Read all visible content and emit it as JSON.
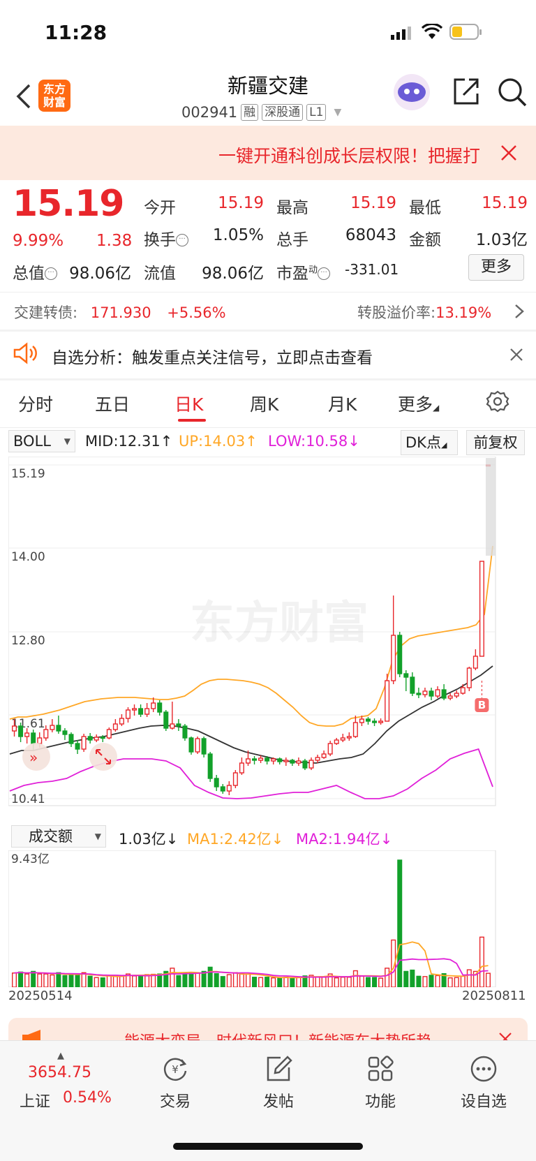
{
  "status_bar": {
    "time": "11:28"
  },
  "header": {
    "logo_text": "东方财富",
    "stock_name": "新疆交建",
    "stock_code": "002941",
    "tags": [
      "融",
      "深股通",
      "L1"
    ]
  },
  "banner": {
    "text": "一键开通科创成长层权限！把握打"
  },
  "quote": {
    "price": "15.19",
    "change_pct": "9.99%",
    "change": "1.38",
    "open_label": "今开",
    "open": "15.19",
    "high_label": "最高",
    "high": "15.19",
    "low_label": "最低",
    "low": "15.19",
    "turnover_label": "换手",
    "turnover": "1.05%",
    "volume_label": "总手",
    "volume": "68043",
    "amount_label": "金额",
    "amount": "1.03亿",
    "mktcap_label": "总值",
    "mktcap": "98.06亿",
    "float_label": "流值",
    "float_cap": "98.06亿",
    "pe_label": "市盈",
    "pe_sup": "动",
    "pe": "-331.01",
    "more_label": "更多"
  },
  "bond": {
    "label": "交建转债:",
    "price": "171.930",
    "change": "+5.56%",
    "premium_label": "转股溢价率:",
    "premium": "13.19%"
  },
  "analysis": {
    "text": "自选分析：触发重点关注信号，立即点击查看"
  },
  "tabs": [
    "分时",
    "五日",
    "日K",
    "周K",
    "月K",
    "更多"
  ],
  "active_tab": "日K",
  "indicator": {
    "name": "BOLL",
    "mid": "MID:12.31",
    "up": "UP:14.03",
    "low": "LOW:10.58",
    "dk_label": "DK点",
    "adjust_label": "前复权"
  },
  "price_axis": [
    "15.19",
    "14.00",
    "12.80",
    "11.61",
    "10.41"
  ],
  "watermark": "东方财富",
  "buy_marker": "B",
  "volume_indicator": {
    "name": "成交额",
    "value": "1.03亿",
    "ma1": "MA1:2.42亿",
    "ma2": "MA2:1.94亿",
    "max_label": "9.43亿"
  },
  "dates": {
    "start": "20250514",
    "end": "20250811"
  },
  "ad": {
    "text": "能源大变局，时代新风口！新能源车大势所趋"
  },
  "bottom_nav": {
    "index_value": "3654.75",
    "index_name": "上证",
    "index_change": "0.54%",
    "items": [
      "交易",
      "发帖",
      "功能",
      "设自选"
    ]
  },
  "colors": {
    "up": "#e8262b",
    "down": "#12a12a",
    "mid": "#333333",
    "upper": "#ffa726",
    "lower": "#e020d8"
  },
  "chart_data": {
    "type": "candlestick",
    "x_range": [
      "20250514",
      "20250811"
    ],
    "ylim": [
      10.41,
      15.19
    ],
    "candles": [
      [
        11.38,
        11.45,
        11.55,
        11.3
      ],
      [
        11.45,
        11.3,
        11.5,
        11.22
      ],
      [
        11.3,
        11.35,
        11.42,
        11.2
      ],
      [
        11.35,
        11.2,
        11.4,
        11.1
      ],
      [
        11.2,
        11.28,
        11.36,
        11.14
      ],
      [
        11.28,
        11.4,
        11.46,
        11.24
      ],
      [
        11.4,
        11.46,
        11.55,
        11.36
      ],
      [
        11.46,
        11.38,
        11.6,
        11.34
      ],
      [
        11.38,
        11.33,
        11.42,
        11.25
      ],
      [
        11.33,
        11.2,
        11.36,
        11.15
      ],
      [
        11.2,
        11.12,
        11.25,
        11.05
      ],
      [
        11.12,
        11.3,
        11.34,
        11.08
      ],
      [
        11.3,
        11.25,
        11.35,
        11.2
      ],
      [
        11.25,
        11.29,
        11.33,
        11.22
      ],
      [
        11.29,
        11.28,
        11.32,
        11.22
      ],
      [
        11.28,
        11.4,
        11.43,
        11.26
      ],
      [
        11.4,
        11.48,
        11.55,
        11.37
      ],
      [
        11.48,
        11.56,
        11.62,
        11.45
      ],
      [
        11.56,
        11.68,
        11.72,
        11.5
      ],
      [
        11.68,
        11.7,
        11.76,
        11.6
      ],
      [
        11.7,
        11.62,
        11.76,
        11.58
      ],
      [
        11.62,
        11.7,
        11.78,
        11.58
      ],
      [
        11.7,
        11.78,
        11.86,
        11.65
      ],
      [
        11.78,
        11.65,
        11.82,
        11.6
      ],
      [
        11.65,
        11.42,
        11.68,
        11.38
      ],
      [
        11.42,
        11.48,
        11.8,
        11.4
      ],
      [
        11.48,
        11.45,
        11.55,
        11.38
      ],
      [
        11.45,
        11.28,
        11.48,
        11.24
      ],
      [
        11.28,
        11.08,
        11.3,
        11.04
      ],
      [
        11.08,
        11.27,
        11.3,
        11.05
      ],
      [
        11.27,
        11.05,
        11.3,
        11.0
      ],
      [
        11.05,
        10.7,
        11.08,
        10.65
      ],
      [
        10.7,
        10.58,
        10.75,
        10.52
      ],
      [
        10.58,
        10.52,
        10.62,
        10.48
      ],
      [
        10.52,
        10.6,
        10.66,
        10.46
      ],
      [
        10.6,
        10.78,
        10.82,
        10.56
      ],
      [
        10.78,
        10.92,
        11.0,
        10.75
      ],
      [
        10.92,
        10.98,
        11.1,
        10.88
      ],
      [
        10.98,
        10.96,
        11.02,
        10.9
      ],
      [
        10.96,
        10.99,
        11.03,
        10.92
      ],
      [
        10.99,
        10.95,
        11.02,
        10.9
      ],
      [
        10.95,
        10.98,
        11.0,
        10.9
      ],
      [
        10.98,
        10.94,
        11.0,
        10.9
      ],
      [
        10.94,
        10.96,
        11.0,
        10.88
      ],
      [
        10.96,
        10.92,
        10.98,
        10.88
      ],
      [
        10.92,
        10.95,
        11.0,
        10.88
      ],
      [
        10.95,
        10.85,
        10.98,
        10.82
      ],
      [
        10.85,
        10.96,
        11.0,
        10.82
      ],
      [
        10.96,
        11.0,
        11.04,
        10.92
      ],
      [
        11.0,
        11.05,
        11.1,
        10.98
      ],
      [
        11.05,
        11.2,
        11.24,
        11.02
      ],
      [
        11.2,
        11.25,
        11.28,
        11.18
      ],
      [
        11.25,
        11.28,
        11.34,
        11.22
      ],
      [
        11.28,
        11.3,
        11.36,
        11.24
      ],
      [
        11.3,
        11.5,
        11.6,
        11.28
      ],
      [
        11.5,
        11.55,
        11.6,
        11.45
      ],
      [
        11.55,
        11.52,
        11.58,
        11.47
      ],
      [
        11.52,
        11.5,
        11.56,
        11.45
      ],
      [
        11.5,
        11.52,
        11.56,
        11.47
      ],
      [
        11.52,
        12.1,
        12.2,
        11.8
      ],
      [
        12.1,
        12.75,
        13.32,
        12.05
      ],
      [
        12.75,
        12.2,
        12.8,
        12.15
      ],
      [
        12.2,
        12.15,
        12.25,
        11.95
      ],
      [
        12.15,
        11.92,
        12.22,
        11.88
      ],
      [
        11.92,
        11.9,
        12.0,
        11.85
      ],
      [
        11.9,
        11.95,
        12.0,
        11.86
      ],
      [
        11.95,
        11.88,
        12.0,
        11.82
      ],
      [
        11.88,
        11.97,
        12.02,
        11.85
      ],
      [
        11.97,
        11.85,
        12.05,
        11.82
      ],
      [
        11.85,
        11.88,
        11.92,
        11.82
      ],
      [
        11.88,
        11.92,
        11.96,
        11.85
      ],
      [
        11.92,
        12.0,
        12.05,
        11.9
      ],
      [
        12.0,
        12.28,
        12.3,
        11.95
      ],
      [
        12.28,
        12.45,
        12.55,
        12.25
      ],
      [
        12.45,
        13.81,
        13.81,
        12.45
      ],
      [
        15.19,
        15.19,
        15.19,
        15.19
      ]
    ],
    "boll_upper": [
      11.55,
      11.58,
      11.58,
      11.6,
      11.62,
      11.65,
      11.68,
      11.72,
      11.76,
      11.8,
      11.82,
      11.84,
      11.85,
      11.86,
      11.86,
      11.86,
      11.85,
      11.84,
      11.83,
      11.83,
      11.85,
      11.88,
      11.96,
      12.05,
      12.1,
      12.12,
      12.12,
      12.11,
      12.1,
      12.08,
      12.05,
      12.0,
      11.92,
      11.82,
      11.72,
      11.6,
      11.5,
      11.46,
      11.45,
      11.45,
      11.48,
      11.56,
      11.58,
      11.6,
      11.7,
      12.0,
      12.4,
      12.6,
      12.7,
      12.74,
      12.76,
      12.78,
      12.8,
      12.82,
      12.84,
      12.86,
      12.9,
      13.05,
      14.03
    ],
    "boll_mid": [
      11.05,
      11.1,
      11.1,
      11.14,
      11.18,
      11.22,
      11.25,
      11.28,
      11.3,
      11.34,
      11.38,
      11.42,
      11.45,
      11.46,
      11.45,
      11.42,
      11.38,
      11.3,
      11.22,
      11.14,
      11.08,
      11.04,
      11.0,
      10.96,
      10.94,
      10.93,
      10.92,
      10.95,
      10.98,
      11.0,
      11.05,
      11.2,
      11.38,
      11.52,
      11.62,
      11.72,
      11.8,
      11.9,
      11.98,
      12.08,
      12.18,
      12.31
    ],
    "boll_lower": [
      10.52,
      10.6,
      10.64,
      10.66,
      10.7,
      10.8,
      10.88,
      10.94,
      10.98,
      10.98,
      10.98,
      10.95,
      10.85,
      10.6,
      10.5,
      10.42,
      10.41,
      10.42,
      10.45,
      10.48,
      10.5,
      10.5,
      10.55,
      10.6,
      10.5,
      10.41,
      10.41,
      10.45,
      10.55,
      10.7,
      10.82,
      10.98,
      11.06,
      11.12,
      10.58
    ],
    "volume_series": {
      "max_label_value": 9.43,
      "unit": "亿",
      "latest": 1.03,
      "ma1": 2.42,
      "ma2": 1.94
    }
  }
}
